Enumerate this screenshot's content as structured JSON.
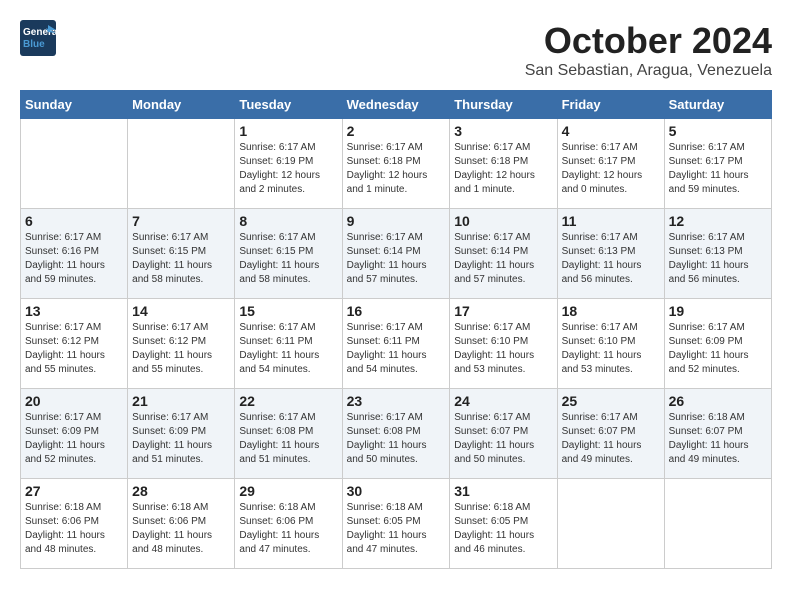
{
  "header": {
    "logo_line1": "General",
    "logo_line2": "Blue",
    "title": "October 2024",
    "location": "San Sebastian, Aragua, Venezuela"
  },
  "days_of_week": [
    "Sunday",
    "Monday",
    "Tuesday",
    "Wednesday",
    "Thursday",
    "Friday",
    "Saturday"
  ],
  "weeks": [
    [
      {
        "day": "",
        "sunrise": "",
        "sunset": "",
        "daylight": ""
      },
      {
        "day": "",
        "sunrise": "",
        "sunset": "",
        "daylight": ""
      },
      {
        "day": "1",
        "sunrise": "Sunrise: 6:17 AM",
        "sunset": "Sunset: 6:19 PM",
        "daylight": "Daylight: 12 hours and 2 minutes."
      },
      {
        "day": "2",
        "sunrise": "Sunrise: 6:17 AM",
        "sunset": "Sunset: 6:18 PM",
        "daylight": "Daylight: 12 hours and 1 minute."
      },
      {
        "day": "3",
        "sunrise": "Sunrise: 6:17 AM",
        "sunset": "Sunset: 6:18 PM",
        "daylight": "Daylight: 12 hours and 1 minute."
      },
      {
        "day": "4",
        "sunrise": "Sunrise: 6:17 AM",
        "sunset": "Sunset: 6:17 PM",
        "daylight": "Daylight: 12 hours and 0 minutes."
      },
      {
        "day": "5",
        "sunrise": "Sunrise: 6:17 AM",
        "sunset": "Sunset: 6:17 PM",
        "daylight": "Daylight: 11 hours and 59 minutes."
      }
    ],
    [
      {
        "day": "6",
        "sunrise": "Sunrise: 6:17 AM",
        "sunset": "Sunset: 6:16 PM",
        "daylight": "Daylight: 11 hours and 59 minutes."
      },
      {
        "day": "7",
        "sunrise": "Sunrise: 6:17 AM",
        "sunset": "Sunset: 6:15 PM",
        "daylight": "Daylight: 11 hours and 58 minutes."
      },
      {
        "day": "8",
        "sunrise": "Sunrise: 6:17 AM",
        "sunset": "Sunset: 6:15 PM",
        "daylight": "Daylight: 11 hours and 58 minutes."
      },
      {
        "day": "9",
        "sunrise": "Sunrise: 6:17 AM",
        "sunset": "Sunset: 6:14 PM",
        "daylight": "Daylight: 11 hours and 57 minutes."
      },
      {
        "day": "10",
        "sunrise": "Sunrise: 6:17 AM",
        "sunset": "Sunset: 6:14 PM",
        "daylight": "Daylight: 11 hours and 57 minutes."
      },
      {
        "day": "11",
        "sunrise": "Sunrise: 6:17 AM",
        "sunset": "Sunset: 6:13 PM",
        "daylight": "Daylight: 11 hours and 56 minutes."
      },
      {
        "day": "12",
        "sunrise": "Sunrise: 6:17 AM",
        "sunset": "Sunset: 6:13 PM",
        "daylight": "Daylight: 11 hours and 56 minutes."
      }
    ],
    [
      {
        "day": "13",
        "sunrise": "Sunrise: 6:17 AM",
        "sunset": "Sunset: 6:12 PM",
        "daylight": "Daylight: 11 hours and 55 minutes."
      },
      {
        "day": "14",
        "sunrise": "Sunrise: 6:17 AM",
        "sunset": "Sunset: 6:12 PM",
        "daylight": "Daylight: 11 hours and 55 minutes."
      },
      {
        "day": "15",
        "sunrise": "Sunrise: 6:17 AM",
        "sunset": "Sunset: 6:11 PM",
        "daylight": "Daylight: 11 hours and 54 minutes."
      },
      {
        "day": "16",
        "sunrise": "Sunrise: 6:17 AM",
        "sunset": "Sunset: 6:11 PM",
        "daylight": "Daylight: 11 hours and 54 minutes."
      },
      {
        "day": "17",
        "sunrise": "Sunrise: 6:17 AM",
        "sunset": "Sunset: 6:10 PM",
        "daylight": "Daylight: 11 hours and 53 minutes."
      },
      {
        "day": "18",
        "sunrise": "Sunrise: 6:17 AM",
        "sunset": "Sunset: 6:10 PM",
        "daylight": "Daylight: 11 hours and 53 minutes."
      },
      {
        "day": "19",
        "sunrise": "Sunrise: 6:17 AM",
        "sunset": "Sunset: 6:09 PM",
        "daylight": "Daylight: 11 hours and 52 minutes."
      }
    ],
    [
      {
        "day": "20",
        "sunrise": "Sunrise: 6:17 AM",
        "sunset": "Sunset: 6:09 PM",
        "daylight": "Daylight: 11 hours and 52 minutes."
      },
      {
        "day": "21",
        "sunrise": "Sunrise: 6:17 AM",
        "sunset": "Sunset: 6:09 PM",
        "daylight": "Daylight: 11 hours and 51 minutes."
      },
      {
        "day": "22",
        "sunrise": "Sunrise: 6:17 AM",
        "sunset": "Sunset: 6:08 PM",
        "daylight": "Daylight: 11 hours and 51 minutes."
      },
      {
        "day": "23",
        "sunrise": "Sunrise: 6:17 AM",
        "sunset": "Sunset: 6:08 PM",
        "daylight": "Daylight: 11 hours and 50 minutes."
      },
      {
        "day": "24",
        "sunrise": "Sunrise: 6:17 AM",
        "sunset": "Sunset: 6:07 PM",
        "daylight": "Daylight: 11 hours and 50 minutes."
      },
      {
        "day": "25",
        "sunrise": "Sunrise: 6:17 AM",
        "sunset": "Sunset: 6:07 PM",
        "daylight": "Daylight: 11 hours and 49 minutes."
      },
      {
        "day": "26",
        "sunrise": "Sunrise: 6:18 AM",
        "sunset": "Sunset: 6:07 PM",
        "daylight": "Daylight: 11 hours and 49 minutes."
      }
    ],
    [
      {
        "day": "27",
        "sunrise": "Sunrise: 6:18 AM",
        "sunset": "Sunset: 6:06 PM",
        "daylight": "Daylight: 11 hours and 48 minutes."
      },
      {
        "day": "28",
        "sunrise": "Sunrise: 6:18 AM",
        "sunset": "Sunset: 6:06 PM",
        "daylight": "Daylight: 11 hours and 48 minutes."
      },
      {
        "day": "29",
        "sunrise": "Sunrise: 6:18 AM",
        "sunset": "Sunset: 6:06 PM",
        "daylight": "Daylight: 11 hours and 47 minutes."
      },
      {
        "day": "30",
        "sunrise": "Sunrise: 6:18 AM",
        "sunset": "Sunset: 6:05 PM",
        "daylight": "Daylight: 11 hours and 47 minutes."
      },
      {
        "day": "31",
        "sunrise": "Sunrise: 6:18 AM",
        "sunset": "Sunset: 6:05 PM",
        "daylight": "Daylight: 11 hours and 46 minutes."
      },
      {
        "day": "",
        "sunrise": "",
        "sunset": "",
        "daylight": ""
      },
      {
        "day": "",
        "sunrise": "",
        "sunset": "",
        "daylight": ""
      }
    ]
  ]
}
